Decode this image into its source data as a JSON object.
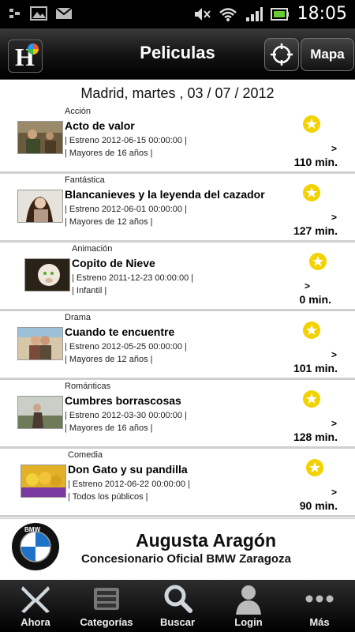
{
  "status_bar": {
    "time": "18:05"
  },
  "header": {
    "title": "Peliculas",
    "map_button": "Mapa"
  },
  "date_line": "Madrid, martes , 03 / 07 / 2012",
  "movies": [
    {
      "genre": "Acción",
      "title": "Acto de valor",
      "release": "| Estreno 2012-06-15 00:00:00 |",
      "rating": "| Mayores de 16 años |",
      "chevron": ">",
      "duration": "110 min."
    },
    {
      "genre": "Fantástica",
      "title": "Blancanieves y la leyenda del cazador",
      "release": "| Estreno 2012-06-01 00:00:00 |",
      "rating": "| Mayores de 12 años |",
      "chevron": ">",
      "duration": "127 min."
    },
    {
      "genre": "Animación",
      "title": "Copito de Nieve",
      "release": "| Estreno 2011-12-23 00:00:00 |",
      "rating": "| Infantil |",
      "chevron": ">",
      "duration": "0 min."
    },
    {
      "genre": "Drama",
      "title": "Cuando te encuentre",
      "release": "| Estreno 2012-05-25 00:00:00 |",
      "rating": "| Mayores de 12 años |",
      "chevron": ">",
      "duration": "101 min."
    },
    {
      "genre": "Románticas",
      "title": "Cumbres borrascosas",
      "release": "| Estreno 2012-03-30 00:00:00 |",
      "rating": "| Mayores de 16 años |",
      "chevron": ">",
      "duration": "128 min."
    },
    {
      "genre": "Comedia",
      "title": "Don Gato y su pandilla",
      "release": "| Estreno 2012-06-22 00:00:00 |",
      "rating": "| Todos los públicos |",
      "chevron": ">",
      "duration": "90 min."
    }
  ],
  "ad": {
    "title": "Augusta Aragón",
    "subtitle": "Concesionario Oficial BMW Zaragoza",
    "logo_text": "BMW"
  },
  "bottom_nav": [
    {
      "label": "Ahora",
      "icon": "ahora-icon"
    },
    {
      "label": "Categorías",
      "icon": "categories-icon"
    },
    {
      "label": "Buscar",
      "icon": "search-icon"
    },
    {
      "label": "Login",
      "icon": "user-icon"
    },
    {
      "label": "Más",
      "icon": "more-icon"
    }
  ],
  "colors": {
    "star": "#f2d200",
    "header": "#111111",
    "separator": "#cfcfcf"
  }
}
